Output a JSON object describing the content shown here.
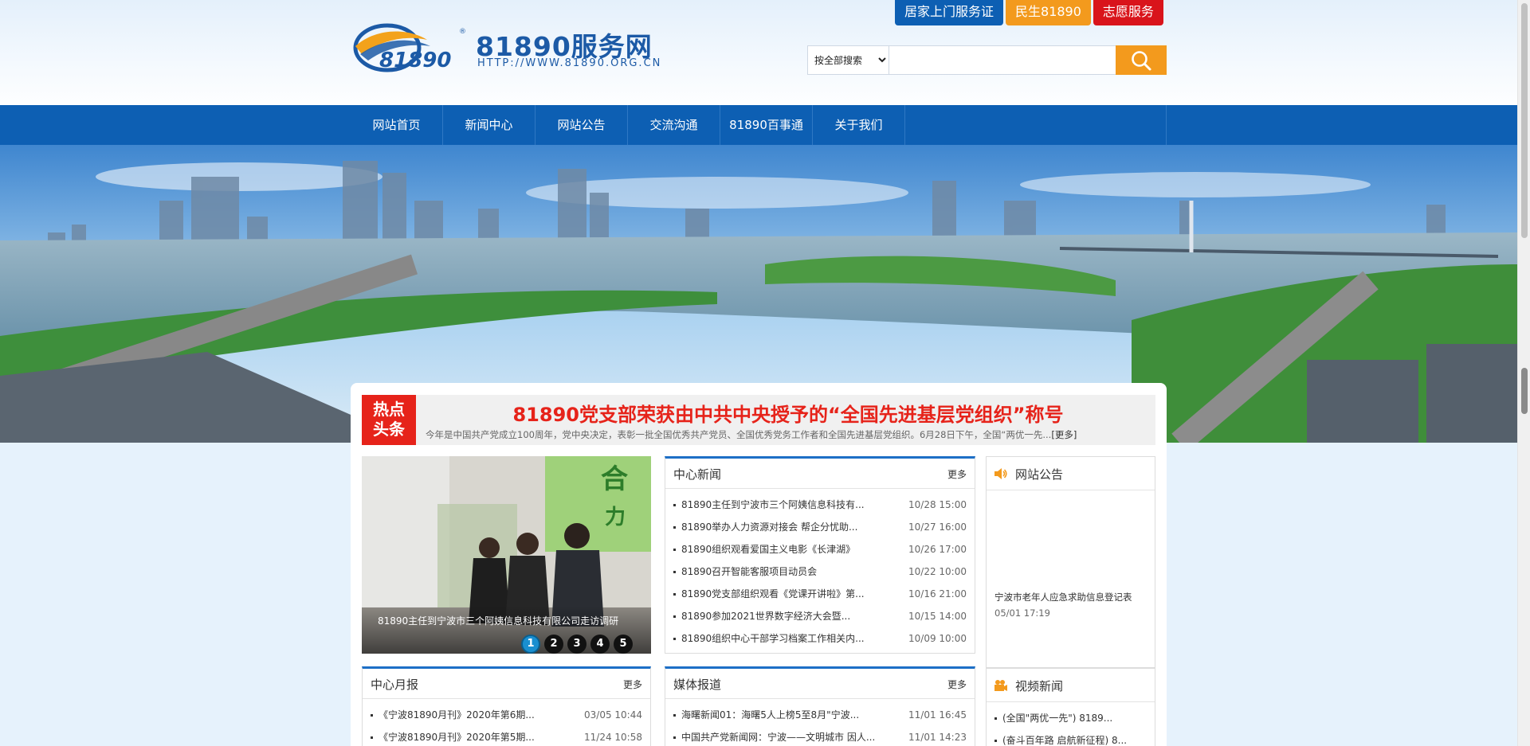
{
  "header": {
    "logo_mark_text": "81890",
    "logo_title": "81890服务网",
    "logo_url": "HTTP://WWW.81890.ORG.CN",
    "top_links": [
      {
        "label": "居家上门服务证",
        "color": "#0d5fb3"
      },
      {
        "label": "民生81890",
        "color": "#f39a1d"
      },
      {
        "label": "志愿服务",
        "color": "#d9141b"
      }
    ],
    "search": {
      "select_value": "按全部搜索",
      "options": [
        "按全部搜索"
      ],
      "input_value": "",
      "placeholder": ""
    }
  },
  "nav": {
    "items": [
      "网站首页",
      "新闻中心",
      "网站公告",
      "交流沟通",
      "81890百事通",
      "关于我们"
    ]
  },
  "headline": {
    "badge_line1": "热点",
    "badge_line2": "头条",
    "title": "81890党支部荣获由中共中央授予的“全国先进基层党组织”称号",
    "desc": "今年是中国共产党成立100周年，党中央决定，表彰一批全国优秀共产党员、全国优秀党务工作者和全国先进基层党组织。6月28日下午，全国“两优一先...",
    "more": "[更多]"
  },
  "slider": {
    "caption": "81890主任到宁波市三个阿姨信息科技有限公司走访调研",
    "dots": [
      "1",
      "2",
      "3",
      "4",
      "5"
    ],
    "active_dot": 1
  },
  "center_news": {
    "title": "中心新闻",
    "more": "更多",
    "items": [
      {
        "title": "81890主任到宁波市三个阿姨信息科技有...",
        "date": "10/28 15:00"
      },
      {
        "title": "81890举办人力资源对接会 帮企分忧助...",
        "date": "10/27 16:00"
      },
      {
        "title": "81890组织观看爱国主义电影《长津湖》",
        "date": "10/26 17:00"
      },
      {
        "title": "81890召开智能客服项目动员会",
        "date": "10/22 10:00"
      },
      {
        "title": "81890党支部组织观看《党课开讲啦》第...",
        "date": "10/16 21:00"
      },
      {
        "title": "81890参加2021世界数字经济大会暨...",
        "date": "10/15 14:00"
      },
      {
        "title": "81890组织中心干部学习档案工作相关内...",
        "date": "10/09 10:00"
      }
    ]
  },
  "notice": {
    "title": "网站公告",
    "item_title": "宁波市老年人应急求助信息登记表",
    "item_date": "05/01 17:19"
  },
  "monthly": {
    "title": "中心月报",
    "more": "更多",
    "items": [
      {
        "title": "《宁波81890月刊》2020年第6期...",
        "date": "03/05 10:44"
      },
      {
        "title": "《宁波81890月刊》2020年第5期...",
        "date": "11/24 10:58"
      }
    ]
  },
  "media": {
    "title": "媒体报道",
    "more": "更多",
    "items": [
      {
        "title": "海曙新闻01：海曙5人上榜5至8月\"宁波...",
        "date": "11/01 16:45"
      },
      {
        "title": "中国共产党新闻网：宁波——文明城市 因人...",
        "date": "11/01 14:23"
      }
    ]
  },
  "video": {
    "title": "视频新闻",
    "items": [
      {
        "title": "(全国\"两优一先\") 8189..."
      },
      {
        "title": "(奋斗百年路 启航新征程) 8..."
      }
    ]
  }
}
